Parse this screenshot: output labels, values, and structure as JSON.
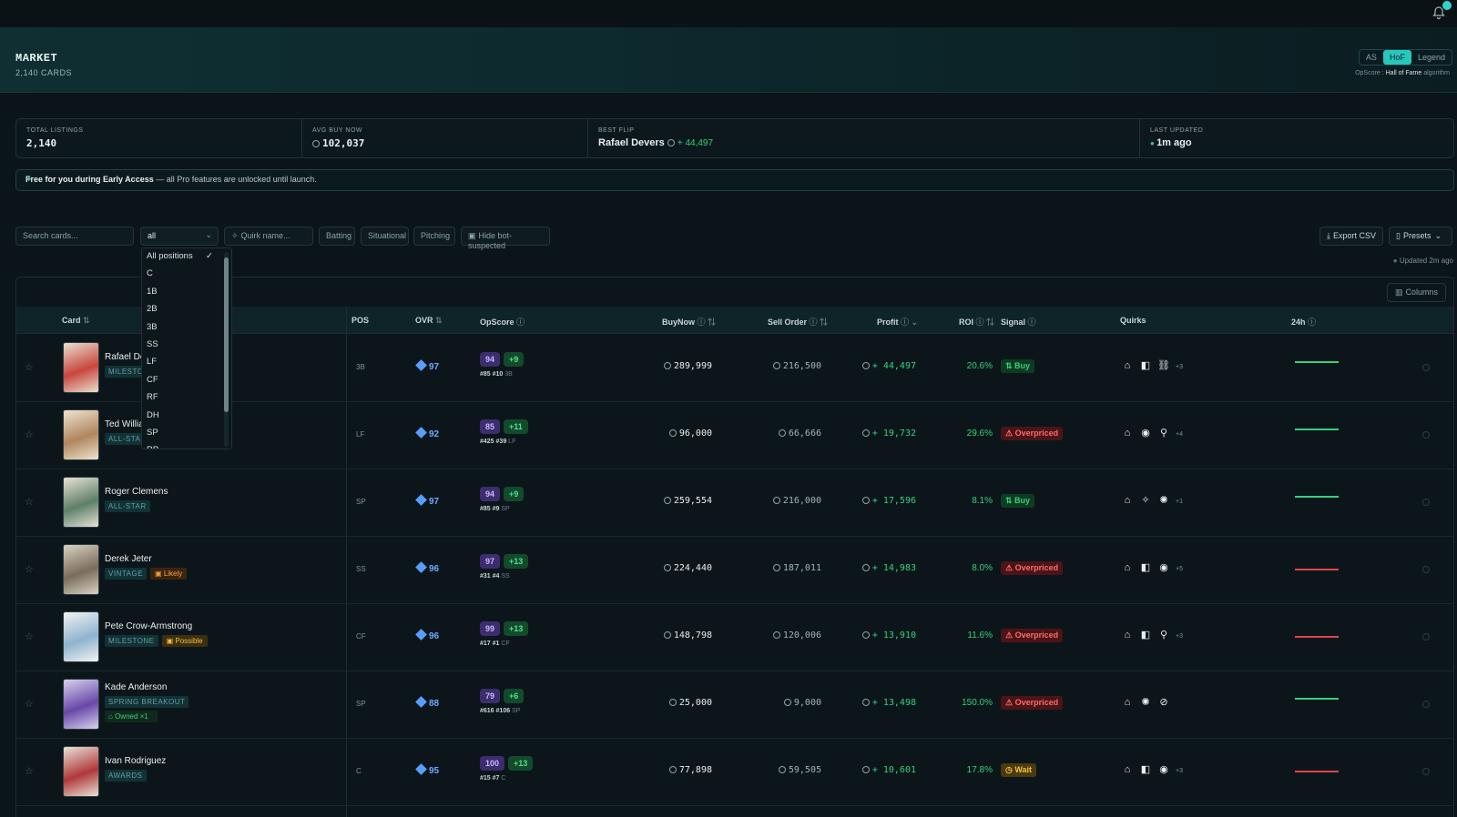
{
  "header": {
    "title": "MARKET",
    "subtitle": "2,140 CARDS",
    "modes": [
      "AS",
      "HoF",
      "Legend"
    ],
    "active_mode": "HoF",
    "opscore_prefix": "OpScore :",
    "opscore_mode": "Hall of Fame",
    "opscore_suffix": "algorithm"
  },
  "stats": {
    "total_listings_label": "TOTAL LISTINGS",
    "total_listings": "2,140",
    "avg_buy_now_label": "AVG BUY NOW",
    "avg_buy_now": "102,037",
    "best_flip_label": "BEST FLIP",
    "best_flip_name": "Rafael Devers",
    "best_flip_profit": "+ 44,497",
    "last_updated_label": "LAST UPDATED",
    "last_updated": "1m ago"
  },
  "banner": {
    "bold": "Free for you during Early Access",
    "text": " — all Pro features are unlocked until launch."
  },
  "filters": {
    "search_placeholder": "Search cards...",
    "position_value": "all",
    "quirk_placeholder": "Quirk name...",
    "batting": "Batting",
    "situational": "Situational",
    "pitching": "Pitching",
    "hide_bot": "Hide bot-suspected",
    "export": "Export CSV",
    "presets": "Presets",
    "updated": "Updated 2m ago",
    "columns": "Columns"
  },
  "dropdown": [
    "All positions",
    "C",
    "1B",
    "2B",
    "3B",
    "SS",
    "LF",
    "CF",
    "RF",
    "DH",
    "SP",
    "RP"
  ],
  "columns": {
    "card": "Card",
    "pos": "POS",
    "ovr": "OVR",
    "opscore": "OpScore",
    "buynow": "BuyNow",
    "sell": "Sell Order",
    "profit": "Profit",
    "roi": "ROI",
    "signal": "Signal",
    "quirks": "Quirks",
    "h24": "24h"
  },
  "rows": [
    {
      "name": "Rafael De",
      "tag": "MILESTO",
      "pos": "3B",
      "ovr": "97",
      "ops": "94",
      "delta": "+9",
      "rank": "#85",
      "rank2": "#10",
      "rpos": "3B",
      "buy": "289,999",
      "sell": "216,500",
      "profit": "+ 44,497",
      "roi": "20.6%",
      "signal": "Buy",
      "sigcls": "buy",
      "more": "+3",
      "trend": "up"
    },
    {
      "name": "Ted Willia",
      "tag": "ALL-STA",
      "pos": "LF",
      "ovr": "92",
      "ops": "85",
      "delta": "+11",
      "rank": "#425",
      "rank2": "#39",
      "rpos": "LF",
      "buy": "96,000",
      "sell": "66,666",
      "profit": "+ 19,732",
      "roi": "29.6%",
      "signal": "Overpriced",
      "sigcls": "over",
      "more": "+4",
      "trend": "up"
    },
    {
      "name": "Roger Clemens",
      "tag": "ALL-STAR",
      "pos": "SP",
      "ovr": "97",
      "ops": "94",
      "delta": "+9",
      "rank": "#85",
      "rank2": "#9",
      "rpos": "SP",
      "buy": "259,554",
      "sell": "216,000",
      "profit": "+ 17,596",
      "roi": "8.1%",
      "signal": "Buy",
      "sigcls": "buy",
      "more": "+1",
      "trend": "up"
    },
    {
      "name": "Derek Jeter",
      "tag": "VINTAGE",
      "badge": "Likely",
      "pos": "SS",
      "ovr": "96",
      "ops": "97",
      "delta": "+13",
      "rank": "#31",
      "rank2": "#4",
      "rpos": "SS",
      "buy": "224,440",
      "sell": "187,011",
      "profit": "+ 14,983",
      "roi": "8.0%",
      "signal": "Overpriced",
      "sigcls": "over",
      "more": "+5",
      "trend": "down"
    },
    {
      "name": "Pete Crow-Armstrong",
      "tag": "MILESTONE",
      "badge2": "Possible",
      "pos": "CF",
      "ovr": "96",
      "ops": "99",
      "delta": "+13",
      "rank": "#17",
      "rank2": "#1",
      "rpos": "CF",
      "buy": "148,798",
      "sell": "120,006",
      "profit": "+ 13,910",
      "roi": "11.6%",
      "signal": "Overpriced",
      "sigcls": "over",
      "more": "+3",
      "trend": "down"
    },
    {
      "name": "Kade Anderson",
      "tag": "SPRING BREAKOUT",
      "owned": "Owned ×1",
      "pos": "SP",
      "ovr": "88",
      "ops": "79",
      "delta": "+6",
      "rank": "#616",
      "rank2": "#106",
      "rpos": "SP",
      "buy": "25,000",
      "sell": "9,000",
      "profit": "+ 13,498",
      "roi": "150.0%",
      "signal": "Overpriced",
      "sigcls": "over",
      "more": "",
      "trend": "up"
    },
    {
      "name": "Ivan Rodriguez",
      "tag": "AWARDS",
      "pos": "C",
      "ovr": "95",
      "ops": "100",
      "delta": "+13",
      "rank": "#15",
      "rank2": "#7",
      "rpos": "C",
      "buy": "77,898",
      "sell": "59,505",
      "profit": "+ 10,601",
      "roi": "17.8%",
      "signal": "Wait",
      "sigcls": "wait",
      "more": "+3",
      "trend": "down"
    }
  ],
  "colors": {
    "accent": "#28c7bd",
    "up": "#35d07f",
    "down": "#e0454a"
  }
}
